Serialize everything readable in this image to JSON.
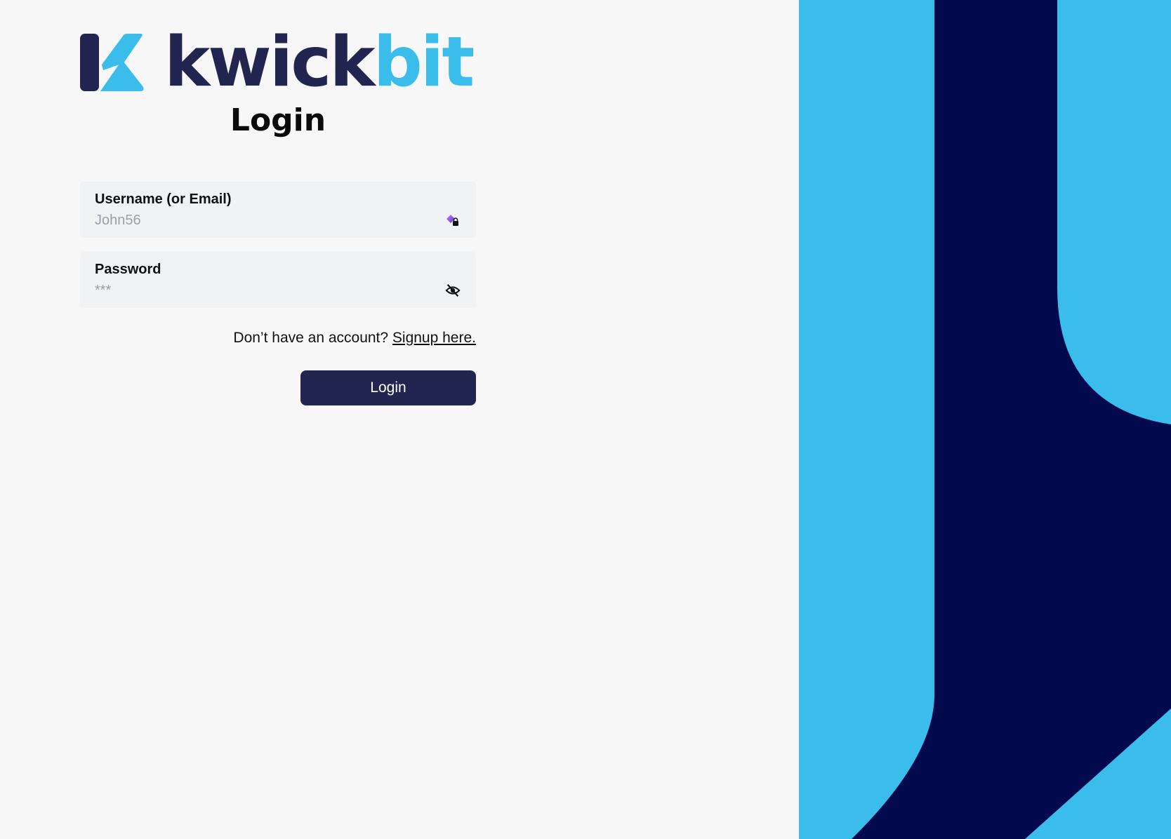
{
  "brand": {
    "name_part1": "kwick",
    "name_part2": "bit",
    "color_dark": "#22254f",
    "color_light": "#3bbdec",
    "logo_icon": "kwickbit-k-logo-icon"
  },
  "page": {
    "title": "Login"
  },
  "form": {
    "username": {
      "label": "Username (or Email)",
      "placeholder": "John56",
      "value": "",
      "icon": "password-manager-key-icon"
    },
    "password": {
      "label": "Password",
      "placeholder": "***",
      "value": "",
      "icon": "eye-off-icon"
    },
    "signup_prompt": "Don’t have an account?",
    "signup_link": "Signup here.",
    "submit_label": "Login"
  },
  "decor": {
    "panel_light": "#3bbdec",
    "panel_dark": "#020a4d"
  }
}
